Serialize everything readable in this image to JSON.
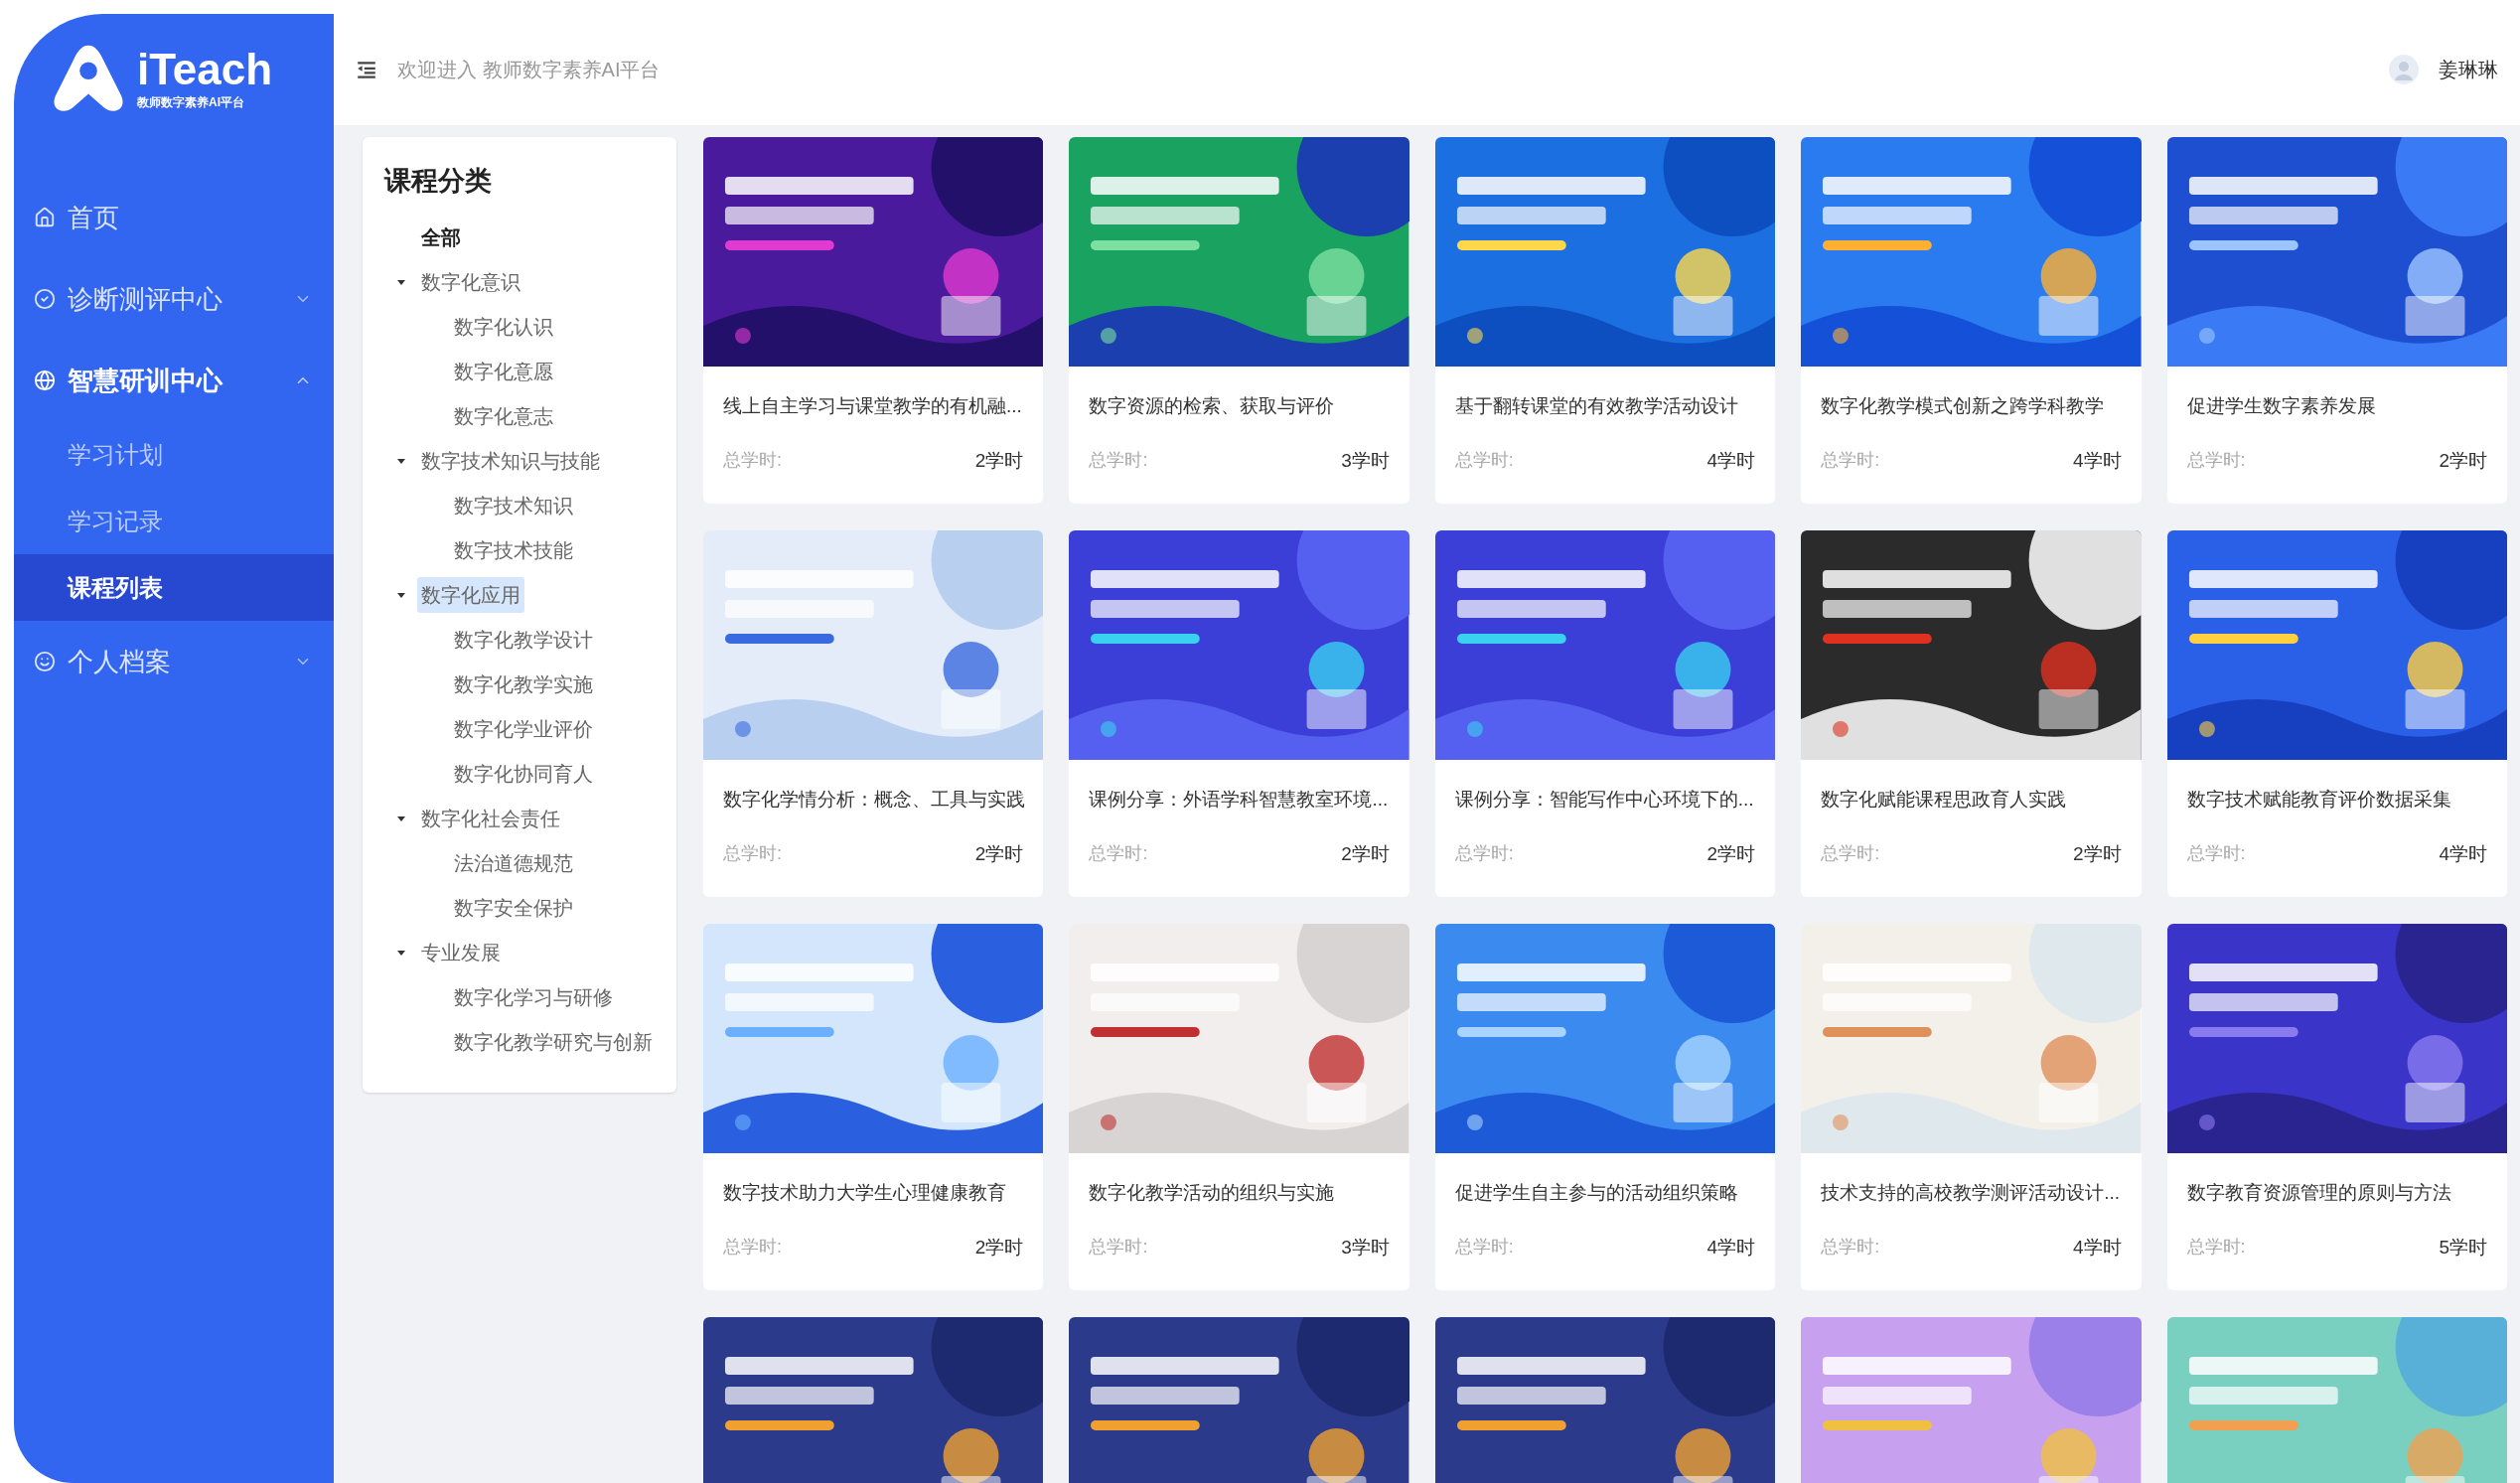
{
  "logo": {
    "name": "iTeach",
    "tagline": "教师数字素养AI平台"
  },
  "sidebar": {
    "items": [
      {
        "kind": "home",
        "label": "首页",
        "selected": false
      },
      {
        "kind": "check",
        "label": "诊断测评中心",
        "selected": false,
        "expanded": false
      },
      {
        "kind": "globe",
        "label": "智慧研训中心",
        "selected": false,
        "expanded": true,
        "children": [
          {
            "label": "学习计划",
            "selected": false
          },
          {
            "label": "学习记录",
            "selected": false
          },
          {
            "label": "课程列表",
            "selected": true
          }
        ]
      },
      {
        "kind": "smile",
        "label": "个人档案",
        "selected": false,
        "expanded": false
      }
    ]
  },
  "header": {
    "title": "欢迎进入 教师数字素养AI平台",
    "user": "姜琳琳"
  },
  "categories": {
    "title": "课程分类",
    "tree": [
      {
        "label": "全部",
        "selected": false
      },
      {
        "label": "数字化意识",
        "selected": false,
        "expanded": true,
        "children": [
          {
            "label": "数字化认识",
            "selected": false
          },
          {
            "label": "数字化意愿",
            "selected": false
          },
          {
            "label": "数字化意志",
            "selected": false
          }
        ]
      },
      {
        "label": "数字技术知识与技能",
        "selected": false,
        "expanded": true,
        "children": [
          {
            "label": "数字技术知识",
            "selected": false
          },
          {
            "label": "数字技术技能",
            "selected": false
          }
        ]
      },
      {
        "label": "数字化应用",
        "selected": true,
        "expanded": true,
        "children": [
          {
            "label": "数字化教学设计",
            "selected": false
          },
          {
            "label": "数字化教学实施",
            "selected": false
          },
          {
            "label": "数字化学业评价",
            "selected": false
          },
          {
            "label": "数字化协同育人",
            "selected": false
          }
        ]
      },
      {
        "label": "数字化社会责任",
        "selected": false,
        "expanded": true,
        "children": [
          {
            "label": "法治道德规范",
            "selected": false
          },
          {
            "label": "数字安全保护",
            "selected": false
          }
        ]
      },
      {
        "label": "专业发展",
        "selected": false,
        "expanded": true,
        "children": [
          {
            "label": "数字化学习与研修",
            "selected": false
          },
          {
            "label": "数字化教学研究与创新",
            "selected": false
          }
        ]
      }
    ]
  },
  "courses": [
    {
      "kind": "course",
      "title": "线上自主学习与课堂教学的有机融...",
      "hours_label": "总学时:",
      "hours": "2学时"
    },
    {
      "kind": "course",
      "title": "数字资源的检索、获取与评价",
      "hours_label": "总学时:",
      "hours": "3学时"
    },
    {
      "kind": "course",
      "title": "基于翻转课堂的有效教学活动设计",
      "hours_label": "总学时:",
      "hours": "4学时"
    },
    {
      "kind": "course",
      "title": "数字化教学模式创新之跨学科教学",
      "hours_label": "总学时:",
      "hours": "4学时"
    },
    {
      "kind": "course",
      "title": "促进学生数字素养发展",
      "hours_label": "总学时:",
      "hours": "2学时"
    },
    {
      "kind": "course",
      "title": "数字化学情分析：概念、工具与实践",
      "hours_label": "总学时:",
      "hours": "2学时"
    },
    {
      "kind": "course",
      "title": "课例分享：外语学科智慧教室环境...",
      "hours_label": "总学时:",
      "hours": "2学时"
    },
    {
      "kind": "course",
      "title": "课例分享：智能写作中心环境下的...",
      "hours_label": "总学时:",
      "hours": "2学时"
    },
    {
      "kind": "course",
      "title": "数字化赋能课程思政育人实践",
      "hours_label": "总学时:",
      "hours": "2学时"
    },
    {
      "kind": "course",
      "title": "数字技术赋能教育评价数据采集",
      "hours_label": "总学时:",
      "hours": "4学时"
    },
    {
      "kind": "course",
      "title": "数字技术助力大学生心理健康教育",
      "hours_label": "总学时:",
      "hours": "2学时"
    },
    {
      "kind": "course",
      "title": "数字化教学活动的组织与实施",
      "hours_label": "总学时:",
      "hours": "3学时"
    },
    {
      "kind": "course",
      "title": "促进学生自主参与的活动组织策略",
      "hours_label": "总学时:",
      "hours": "4学时"
    },
    {
      "kind": "course",
      "title": "技术支持的高校教学测评活动设计...",
      "hours_label": "总学时:",
      "hours": "4学时"
    },
    {
      "kind": "course",
      "title": "数字教育资源管理的原则与方法",
      "hours_label": "总学时:",
      "hours": "5学时"
    },
    {
      "kind": "cover"
    },
    {
      "kind": "cover"
    },
    {
      "kind": "cover"
    },
    {
      "kind": "cover"
    },
    {
      "kind": "cover"
    }
  ]
}
